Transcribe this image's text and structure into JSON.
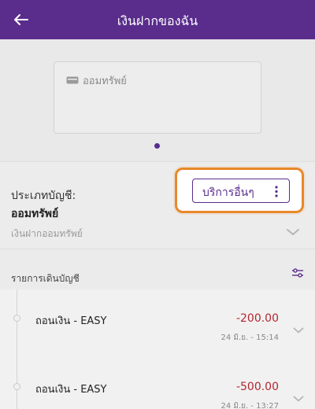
{
  "header": {
    "title": "เงินฝากของฉัน",
    "back_icon": "arrow-left-icon"
  },
  "card": {
    "label": "ออมทรัพย์",
    "icon": "bank-card-icon"
  },
  "account": {
    "type_label": "ประเภทบัญชี:",
    "type_value": "ออมทรัพย์",
    "description": "เงินฝากออมทรัพย์",
    "other_services_label": "บริการอื่นๆ",
    "more_icon": "more-vertical-icon",
    "highlight_color": "#e8882a"
  },
  "transactions": {
    "title": "รายการเดินบัญชี",
    "filter_icon": "filter-sliders-icon",
    "items": [
      {
        "name": "ถอนเงิน - EASY",
        "amount": "-200.00",
        "time": "24 มิ.ย. - 15:14"
      },
      {
        "name": "ถอนเงิน - EASY",
        "amount": "-500.00",
        "time": "24 มิ.ย. - 13:27"
      }
    ]
  },
  "colors": {
    "brand": "#5a2d8c",
    "negative": "#b3262e"
  }
}
